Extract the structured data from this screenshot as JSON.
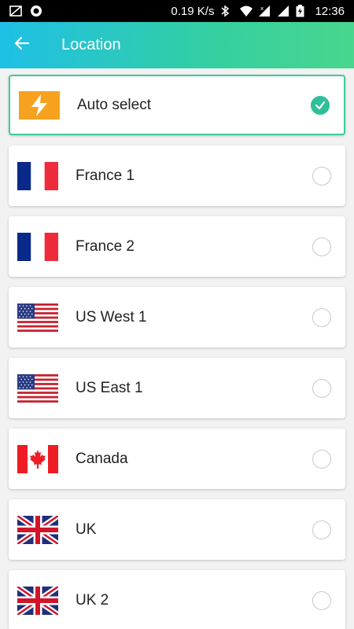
{
  "status_bar": {
    "speed": "0.19 K/s",
    "time": "12:36"
  },
  "app_bar": {
    "title": "Location"
  },
  "locations": [
    {
      "label": "Auto select",
      "flag": "lightning-icon",
      "selected": true
    },
    {
      "label": "France 1",
      "flag": "france-flag",
      "selected": false
    },
    {
      "label": "France 2",
      "flag": "france-flag",
      "selected": false
    },
    {
      "label": "US West 1",
      "flag": "us-flag",
      "selected": false
    },
    {
      "label": "US East 1",
      "flag": "us-flag",
      "selected": false
    },
    {
      "label": "Canada",
      "flag": "canada-flag",
      "selected": false
    },
    {
      "label": "UK",
      "flag": "uk-flag",
      "selected": false
    },
    {
      "label": "UK 2",
      "flag": "uk-flag",
      "selected": false
    }
  ],
  "colors": {
    "accent": "#2fbf9a",
    "app_bar_start": "#1ec0e6",
    "app_bar_end": "#49d68e",
    "auto_select_bg": "#f6a21e"
  }
}
